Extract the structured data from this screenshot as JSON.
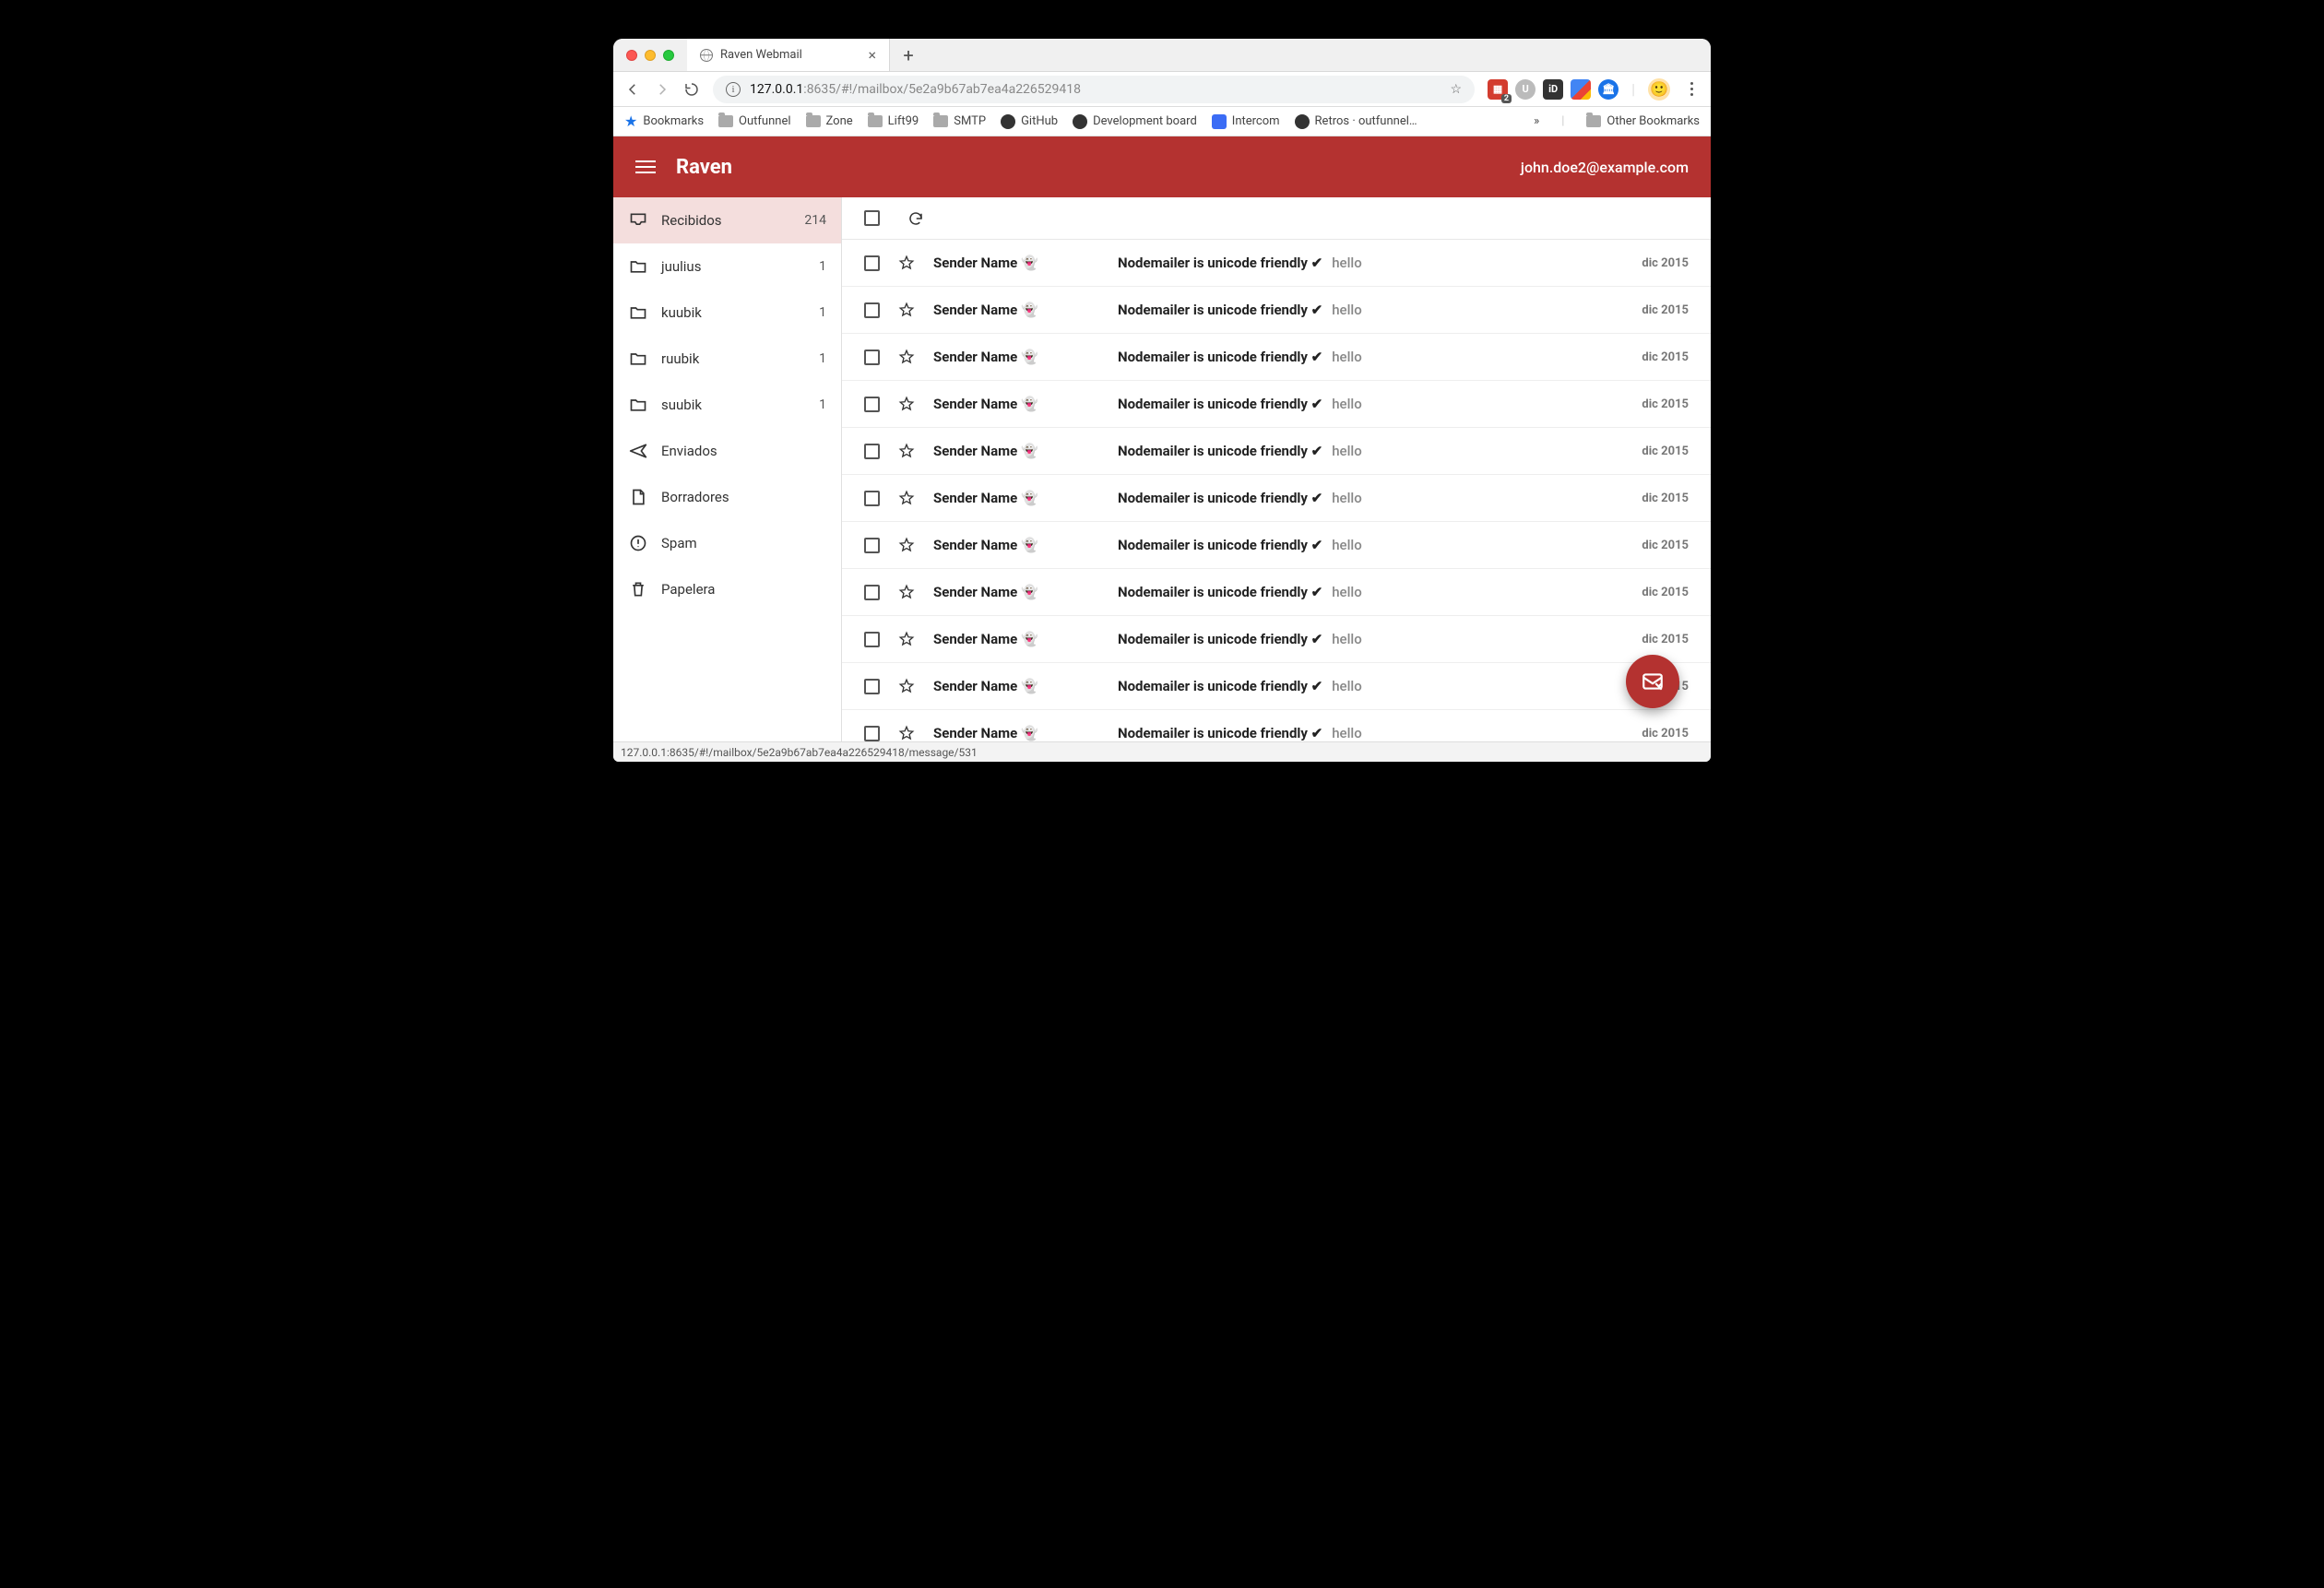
{
  "browser": {
    "tab_title": "Raven Webmail",
    "url_host": "127.0.0.1",
    "url_port": ":8635",
    "url_path": "/#!/mailbox/5e2a9b67ab7ea4a226529418",
    "status_url": "127.0.0.1:8635/#!/mailbox/5e2a9b67ab7ea4a226529418/message/531"
  },
  "bookmarks": {
    "label": "Bookmarks",
    "items": [
      "Outfunnel",
      "Zone",
      "Lift99",
      "SMTP",
      "GitHub",
      "Development board",
      "Intercom",
      "Retros · outfunnel…"
    ],
    "other": "Other Bookmarks"
  },
  "extensions": {
    "badge": "2"
  },
  "app": {
    "name": "Raven",
    "user_email": "john.doe2@example.com"
  },
  "sidebar": {
    "items": [
      {
        "icon": "inbox",
        "label": "Recibidos",
        "count": "214",
        "selected": true
      },
      {
        "icon": "folder",
        "label": "juulius",
        "count": "1"
      },
      {
        "icon": "folder",
        "label": "kuubik",
        "count": "1"
      },
      {
        "icon": "folder",
        "label": "ruubik",
        "count": "1"
      },
      {
        "icon": "folder",
        "label": "suubik",
        "count": "1"
      },
      {
        "icon": "send",
        "label": "Enviados"
      },
      {
        "icon": "draft",
        "label": "Borradores"
      },
      {
        "icon": "spam",
        "label": "Spam"
      },
      {
        "icon": "trash",
        "label": "Papelera"
      }
    ]
  },
  "messages": [
    {
      "sender": "Sender Name 👻",
      "subject": "Nodemailer is unicode friendly ✔",
      "preview": "hello",
      "date": "dic 2015"
    },
    {
      "sender": "Sender Name 👻",
      "subject": "Nodemailer is unicode friendly ✔",
      "preview": "hello",
      "date": "dic 2015"
    },
    {
      "sender": "Sender Name 👻",
      "subject": "Nodemailer is unicode friendly ✔",
      "preview": "hello",
      "date": "dic 2015"
    },
    {
      "sender": "Sender Name 👻",
      "subject": "Nodemailer is unicode friendly ✔",
      "preview": "hello",
      "date": "dic 2015"
    },
    {
      "sender": "Sender Name 👻",
      "subject": "Nodemailer is unicode friendly ✔",
      "preview": "hello",
      "date": "dic 2015"
    },
    {
      "sender": "Sender Name 👻",
      "subject": "Nodemailer is unicode friendly ✔",
      "preview": "hello",
      "date": "dic 2015"
    },
    {
      "sender": "Sender Name 👻",
      "subject": "Nodemailer is unicode friendly ✔",
      "preview": "hello",
      "date": "dic 2015"
    },
    {
      "sender": "Sender Name 👻",
      "subject": "Nodemailer is unicode friendly ✔",
      "preview": "hello",
      "date": "dic 2015"
    },
    {
      "sender": "Sender Name 👻",
      "subject": "Nodemailer is unicode friendly ✔",
      "preview": "hello",
      "date": "dic 2015"
    },
    {
      "sender": "Sender Name 👻",
      "subject": "Nodemailer is unicode friendly ✔",
      "preview": "hello",
      "date": "dic 2015"
    },
    {
      "sender": "Sender Name 👻",
      "subject": "Nodemailer is unicode friendly ✔",
      "preview": "hello",
      "date": "dic 2015"
    }
  ]
}
